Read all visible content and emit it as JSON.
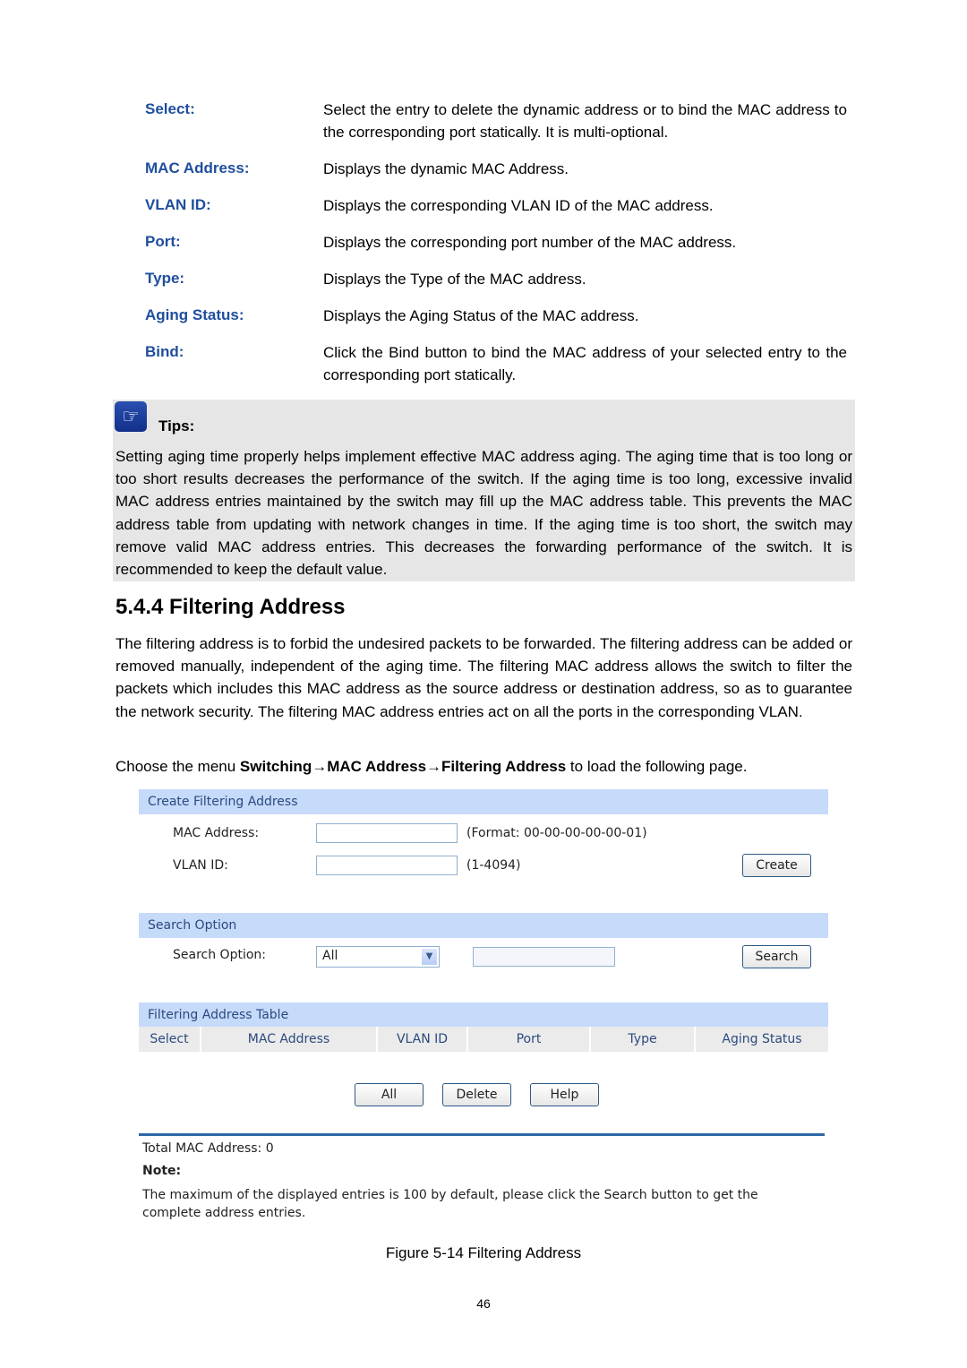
{
  "definitions": [
    {
      "term": "Select:",
      "desc": "Select the entry to delete the dynamic address or to bind the MAC address to the corresponding port statically. It is multi-optional."
    },
    {
      "term": "MAC Address:",
      "desc": "Displays the dynamic MAC Address."
    },
    {
      "term": "VLAN ID:",
      "desc": "Displays the corresponding VLAN ID of the MAC address."
    },
    {
      "term": "Port:",
      "desc": "Displays the corresponding port number of the MAC address."
    },
    {
      "term": "Type:",
      "desc": "Displays the Type of the MAC address."
    },
    {
      "term": "Aging Status:",
      "desc": "Displays the Aging Status of the MAC address."
    },
    {
      "term": "Bind:",
      "desc": "Click the Bind button to bind the MAC address of your selected entry to the corresponding port statically."
    }
  ],
  "tips": {
    "icon": "pointing-hand-icon",
    "title": "Tips:",
    "body": "Setting aging time properly helps implement effective MAC address aging. The aging time that is too long or too short results decreases the performance of the switch. If the aging time is too long, excessive invalid MAC address entries maintained by the switch may fill up the MAC address table. This prevents the MAC address table from updating with network changes in time. If the aging time is too short, the switch may remove valid MAC address entries. This decreases the forwarding performance of the switch. It is recommended to keep the default value."
  },
  "section": {
    "heading": "5.4.4 Filtering Address",
    "intro": "The filtering address is to forbid the undesired packets to be forwarded. The filtering address can be added or removed manually, independent of the aging time. The filtering MAC address allows the switch to filter the packets which includes this MAC address as the source address or destination address, so as to guarantee the network security. The filtering MAC address entries act on all the ports in the corresponding VLAN.",
    "menu_prefix": "Choose the menu ",
    "menu_path": "Switching→MAC Address→Filtering Address",
    "menu_suffix": " to load the following page."
  },
  "figure": {
    "create": {
      "header": "Create Filtering Address",
      "mac_label": "MAC Address:",
      "mac_value": "",
      "mac_hint": "(Format: 00-00-00-00-00-01)",
      "vlan_label": "VLAN ID:",
      "vlan_value": "",
      "vlan_hint": "(1-4094)",
      "create_button": "Create"
    },
    "search": {
      "header": "Search Option",
      "label": "Search Option:",
      "selected": "All",
      "input_value": "",
      "search_button": "Search"
    },
    "table": {
      "header": "Filtering Address Table",
      "columns": [
        "Select",
        "MAC Address",
        "VLAN ID",
        "Port",
        "Type",
        "Aging Status"
      ],
      "rows": []
    },
    "buttons": {
      "all": "All",
      "delete": "Delete",
      "help": "Help"
    },
    "total": "Total MAC Address: 0",
    "note_title": "Note:",
    "note_body": "The maximum of the displayed entries is 100 by default, please click the Search button to get the complete address entries."
  },
  "caption": "Figure 5-14 Filtering Address",
  "page_number": "46"
}
